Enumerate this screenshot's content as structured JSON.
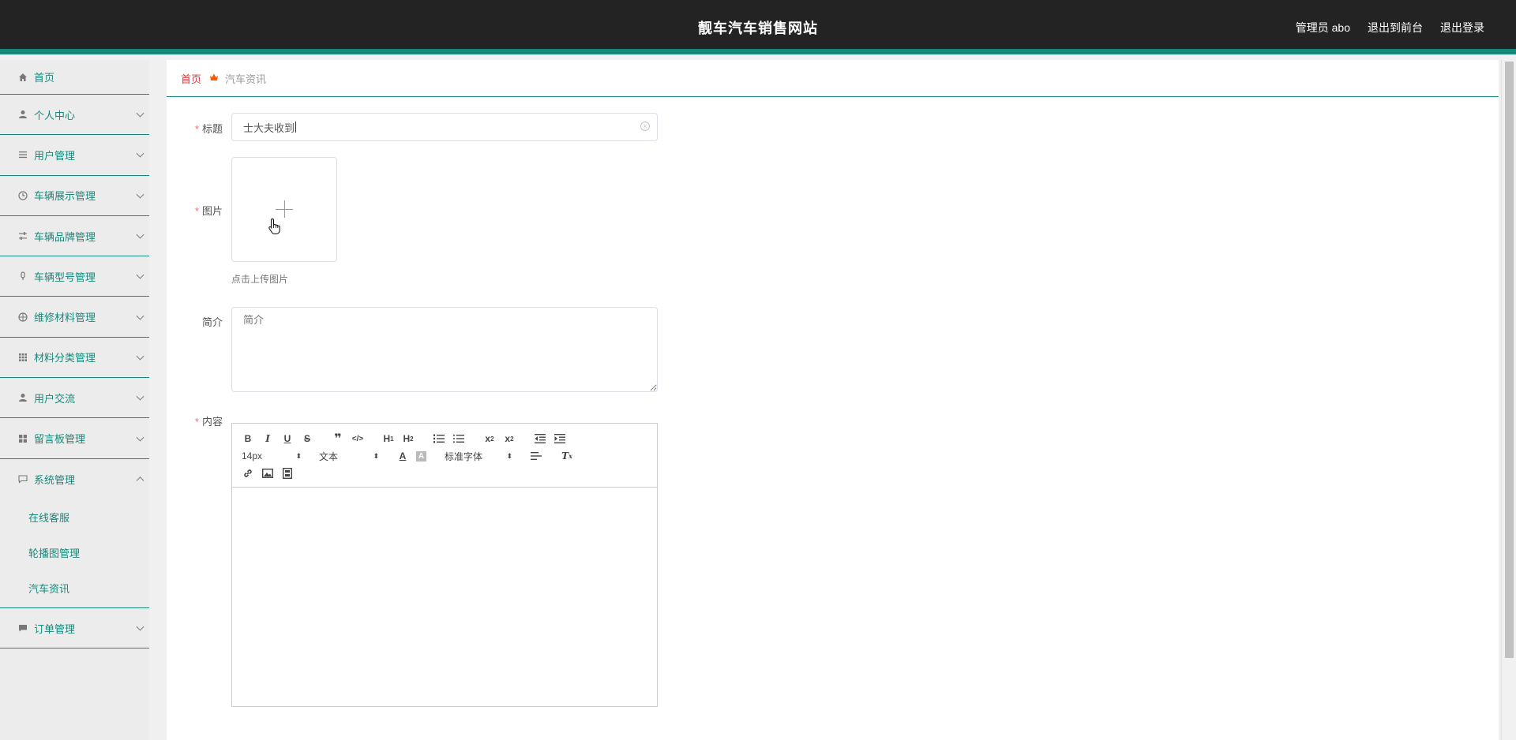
{
  "header": {
    "title": "靓车汽车销售网站",
    "admin_label": "管理员 abo",
    "back_front_label": "退出到前台",
    "logout_label": "退出登录"
  },
  "sidebar": {
    "items": [
      {
        "label": "首页",
        "icon": "home-icon"
      },
      {
        "label": "个人中心",
        "icon": "user-icon"
      },
      {
        "label": "用户管理",
        "icon": "list-icon"
      },
      {
        "label": "车辆展示管理",
        "icon": "clock-icon"
      },
      {
        "label": "车辆品牌管理",
        "icon": "sliders-icon"
      },
      {
        "label": "车辆型号管理",
        "icon": "mic-icon"
      },
      {
        "label": "维修材料管理",
        "icon": "aperture-icon"
      },
      {
        "label": "材料分类管理",
        "icon": "grid-icon"
      },
      {
        "label": "用户交流",
        "icon": "user-icon"
      },
      {
        "label": "留言板管理",
        "icon": "apps-icon"
      },
      {
        "label": "系统管理",
        "icon": "chat-icon"
      },
      {
        "label": "订单管理",
        "icon": "message-icon"
      }
    ],
    "system_subitems": [
      "在线客服",
      "轮播图管理",
      "汽车资讯"
    ]
  },
  "breadcrumb": {
    "home": "首页",
    "current": "汽车资讯"
  },
  "form": {
    "title_label": "标题",
    "title_value": "士大夫收到",
    "image_label": "图片",
    "upload_tip": "点击上传图片",
    "intro_label": "简介",
    "intro_placeholder": "简介",
    "content_label": "内容"
  },
  "editor": {
    "font_size": "14px",
    "header_select": "文本",
    "font_family": "标准字体"
  }
}
